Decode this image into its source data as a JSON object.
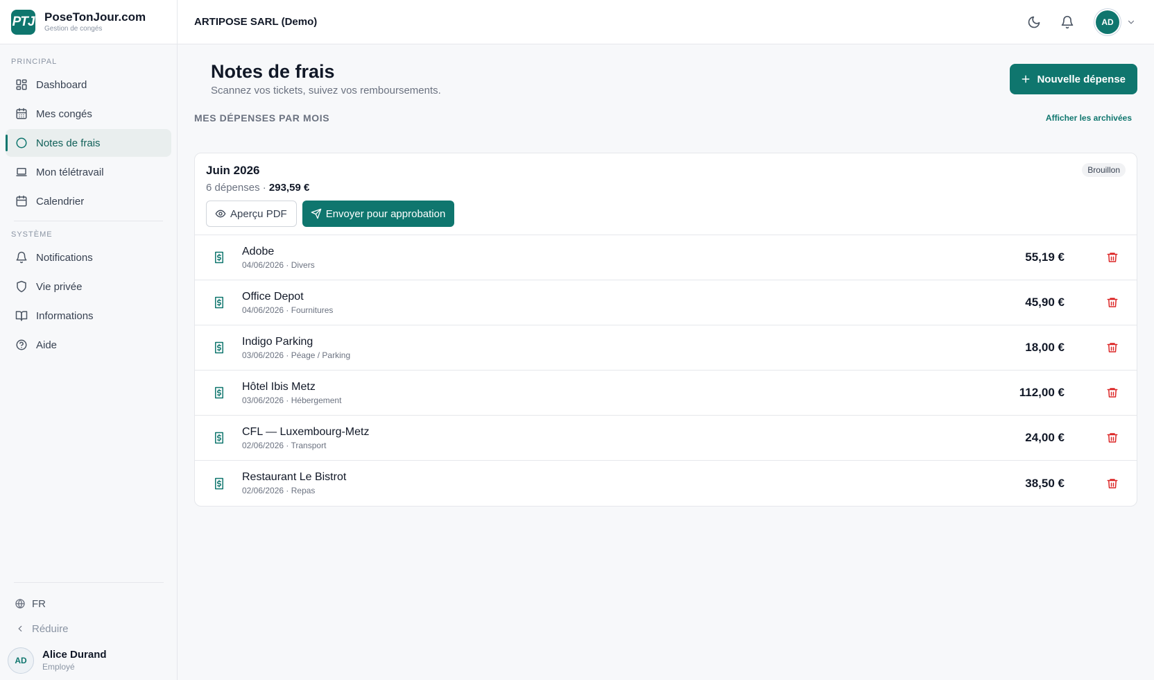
{
  "brand": {
    "logo": "PTJ",
    "name": "PoseTonJour.com",
    "tagline": "Gestion de congés"
  },
  "sidebar": {
    "principal_label": "PRINCIPAL",
    "principal": [
      {
        "label": "Dashboard",
        "icon": "dashboard-icon"
      },
      {
        "label": "Mes congés",
        "icon": "calendar-grid-icon"
      },
      {
        "label": "Notes de frais",
        "icon": "circle-icon",
        "active": true
      },
      {
        "label": "Mon télétravail",
        "icon": "laptop-icon"
      },
      {
        "label": "Calendrier",
        "icon": "calendar-icon"
      }
    ],
    "systeme_label": "SYSTÈME",
    "systeme": [
      {
        "label": "Notifications",
        "icon": "bell-icon"
      },
      {
        "label": "Vie privée",
        "icon": "shield-icon"
      },
      {
        "label": "Informations",
        "icon": "book-icon"
      },
      {
        "label": "Aide",
        "icon": "help-icon"
      }
    ],
    "language": "FR",
    "collapse": "Réduire",
    "user": {
      "initials": "AD",
      "name": "Alice Durand",
      "role": "Employé"
    }
  },
  "topbar": {
    "company": "ARTIPOSE SARL (Demo)",
    "avatar": "AD"
  },
  "page": {
    "title": "Notes de frais",
    "subtitle": "Scannez vos tickets, suivez vos remboursements.",
    "new_button": "Nouvelle dépense",
    "section_title": "MES DÉPENSES PAR MOIS",
    "archives_link": "Afficher les archivées"
  },
  "month": {
    "title": "Juin 2026",
    "count": "6 dépenses · ",
    "total": "293,59 €",
    "status": "Brouillon",
    "preview_button": "Aperçu PDF",
    "send_button": "Envoyer pour approbation"
  },
  "expenses": [
    {
      "vendor": "Adobe",
      "meta": "04/06/2026 · Divers",
      "amount": "55,19 €"
    },
    {
      "vendor": "Office Depot",
      "meta": "04/06/2026 · Fournitures",
      "amount": "45,90 €"
    },
    {
      "vendor": "Indigo Parking",
      "meta": "03/06/2026 · Péage / Parking",
      "amount": "18,00 €"
    },
    {
      "vendor": "Hôtel Ibis Metz",
      "meta": "03/06/2026 · Hébergement",
      "amount": "112,00 €"
    },
    {
      "vendor": "CFL — Luxembourg-Metz",
      "meta": "02/06/2026 · Transport",
      "amount": "24,00 €"
    },
    {
      "vendor": "Restaurant Le Bistrot",
      "meta": "02/06/2026 · Repas",
      "amount": "38,50 €"
    }
  ],
  "colors": {
    "accent": "#0f766e",
    "danger": "#dc2626",
    "background": "#f7f8fa"
  }
}
